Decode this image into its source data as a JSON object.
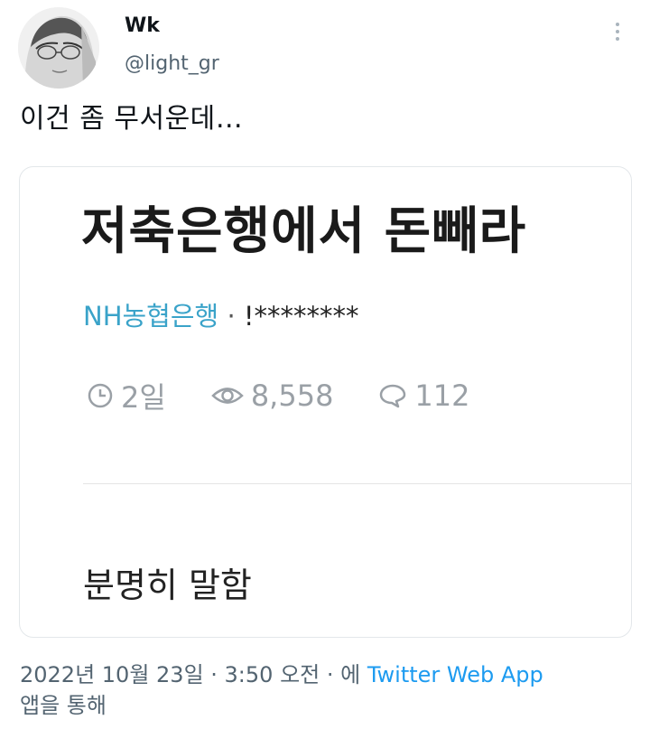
{
  "author": {
    "display_name": "Wk",
    "handle": "@light_gr"
  },
  "tweet": {
    "text": "이건 좀 무서운데…"
  },
  "card": {
    "title": "저축은행에서 돈빼라",
    "source_name": "NH농협은행",
    "source_separator": " · ",
    "author_masked": "!********",
    "stats": {
      "age": "2일",
      "views": "8,558",
      "comments": "112"
    },
    "body_text": "분명히 말함"
  },
  "meta": {
    "timestamp": "2022년 10월 23일 · 3:50 오전 · 에",
    "via_app": "Twitter Web App",
    "via_suffix": "앱을 통해"
  },
  "colors": {
    "link": "#1d9bf0",
    "source_name": "#3aa3c9",
    "secondary_text": "#536471",
    "stat_icon": "#9aa0a6"
  },
  "icons": {
    "more": "more-vertical-icon",
    "age": "clock-icon",
    "views": "eye-icon",
    "comments": "comment-bubble-icon"
  }
}
